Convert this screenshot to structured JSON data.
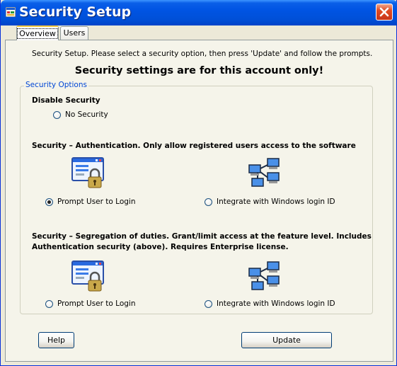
{
  "window": {
    "title": "Security Setup"
  },
  "tabs": [
    {
      "label": "Overview",
      "active": true
    },
    {
      "label": "Users",
      "active": false
    }
  ],
  "intro": "Security Setup.  Please select a security option, then press 'Update' and follow the prompts.",
  "headline": "Security settings are for this account only!",
  "security_options": {
    "group_label": "Security Options",
    "disable": {
      "title": "Disable Security",
      "no_security_label": "No Security",
      "no_security_checked": false
    },
    "authentication": {
      "title": "Security – Authentication.  Only allow registered users access to the software",
      "prompt_label": "Prompt User to Login",
      "prompt_checked": true,
      "windows_label": "Integrate with Windows login ID",
      "windows_checked": false
    },
    "segregation": {
      "title_line1": "Security  – Segregation of duties. Grant/limit access at the feature level.  Includes",
      "title_line2": "Authentication security (above). Requires Enterprise license.",
      "prompt_label": "Prompt User to Login",
      "prompt_checked": false,
      "windows_label": "Integrate with Windows login ID",
      "windows_checked": false
    }
  },
  "buttons": {
    "help": "Help",
    "update": "Update"
  }
}
